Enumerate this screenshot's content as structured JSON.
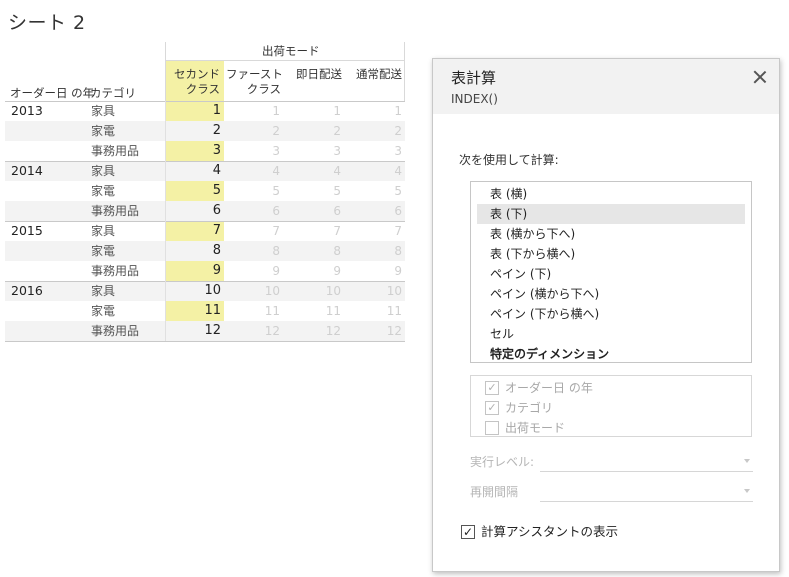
{
  "sheet": {
    "title": "シート 2"
  },
  "crosstab": {
    "column_group_header": "出荷モード",
    "row_headers": {
      "year": "オーダー日 の年",
      "category": "カテゴリ"
    },
    "columns": [
      {
        "line1": "セカンド",
        "line2": "クラス"
      },
      {
        "line1": "ファースト",
        "line2": "クラス"
      },
      {
        "line1": "",
        "line2": "即日配送"
      },
      {
        "line1": "",
        "line2": "通常配送"
      }
    ],
    "rows": [
      {
        "year": "2013",
        "category": "家具",
        "values": [
          "1",
          "1",
          "1",
          "1"
        ]
      },
      {
        "year": "",
        "category": "家電",
        "values": [
          "2",
          "2",
          "2",
          "2"
        ]
      },
      {
        "year": "",
        "category": "事務用品",
        "values": [
          "3",
          "3",
          "3",
          "3"
        ]
      },
      {
        "year": "2014",
        "category": "家具",
        "values": [
          "4",
          "4",
          "4",
          "4"
        ]
      },
      {
        "year": "",
        "category": "家電",
        "values": [
          "5",
          "5",
          "5",
          "5"
        ]
      },
      {
        "year": "",
        "category": "事務用品",
        "values": [
          "6",
          "6",
          "6",
          "6"
        ]
      },
      {
        "year": "2015",
        "category": "家具",
        "values": [
          "7",
          "7",
          "7",
          "7"
        ]
      },
      {
        "year": "",
        "category": "家電",
        "values": [
          "8",
          "8",
          "8",
          "8"
        ]
      },
      {
        "year": "",
        "category": "事務用品",
        "values": [
          "9",
          "9",
          "9",
          "9"
        ]
      },
      {
        "year": "2016",
        "category": "家具",
        "values": [
          "10",
          "10",
          "10",
          "10"
        ]
      },
      {
        "year": "",
        "category": "家電",
        "values": [
          "11",
          "11",
          "11",
          "11"
        ]
      },
      {
        "year": "",
        "category": "事務用品",
        "values": [
          "12",
          "12",
          "12",
          "12"
        ]
      }
    ],
    "highlight_color": "#f4f1a5"
  },
  "dialog": {
    "title": "表計算",
    "subtitle": "INDEX()",
    "close_icon": "close-icon",
    "compute_using_label": "次を使用して計算:",
    "compute_options": [
      {
        "label": "表 (横)",
        "selected": false,
        "bold": false
      },
      {
        "label": "表 (下)",
        "selected": true,
        "bold": false
      },
      {
        "label": "表 (横から下へ)",
        "selected": false,
        "bold": false
      },
      {
        "label": "表 (下から横へ)",
        "selected": false,
        "bold": false
      },
      {
        "label": "ペイン (下)",
        "selected": false,
        "bold": false
      },
      {
        "label": "ペイン (横から下へ)",
        "selected": false,
        "bold": false
      },
      {
        "label": "ペイン (下から横へ)",
        "selected": false,
        "bold": false
      },
      {
        "label": "セル",
        "selected": false,
        "bold": false
      },
      {
        "label": "特定のディメンション",
        "selected": false,
        "bold": true
      }
    ],
    "dimensions": [
      {
        "label": "オーダー日 の年",
        "checked": true
      },
      {
        "label": "カテゴリ",
        "checked": true
      },
      {
        "label": "出荷モード",
        "checked": false
      }
    ],
    "at_level_label": "実行レベル:",
    "at_level_value": "",
    "restart_every_label": "再開間隔",
    "restart_every_value": "",
    "show_assistance_label": "計算アシスタントの表示",
    "show_assistance_checked": true
  }
}
